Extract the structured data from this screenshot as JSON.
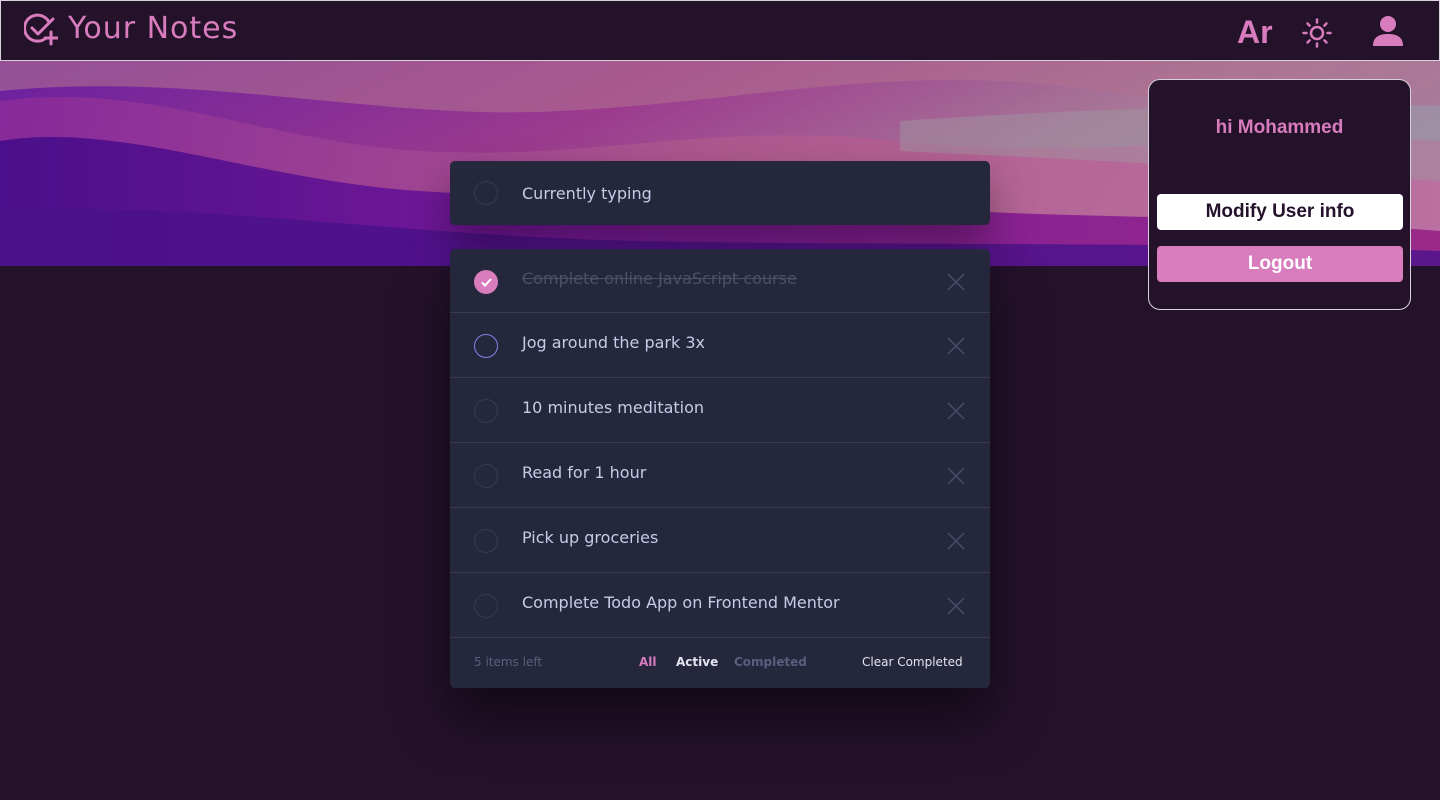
{
  "header": {
    "app_title": "Your Notes",
    "language_toggle": "Ar",
    "logo_icon": "check-circle-plus-icon",
    "theme_icon": "sun-icon",
    "user_icon": "user-icon"
  },
  "new_todo": {
    "value": "Currently typing"
  },
  "todos": [
    {
      "text": "Complete online JavaScript course",
      "completed": true
    },
    {
      "text": "Jog around the park 3x",
      "completed": false
    },
    {
      "text": "10 minutes meditation",
      "completed": false
    },
    {
      "text": "Read for 1 hour",
      "completed": false
    },
    {
      "text": "Pick up groceries",
      "completed": false
    },
    {
      "text": "Complete Todo App on Frontend Mentor",
      "completed": false
    }
  ],
  "footer": {
    "items_left": "5 items left",
    "filters": [
      "All",
      "Active",
      "Completed"
    ],
    "selected_filter": "All",
    "clear_completed": "Clear Completed"
  },
  "user_menu": {
    "greeting": "hi Mohammed",
    "modify_label": "Modify User info",
    "logout_label": "Logout"
  },
  "colors": {
    "background": "#24122b",
    "accent": "#d87cbd",
    "card": "#25273d",
    "text": "#c8cbe7",
    "muted": "#5b5e7e"
  }
}
